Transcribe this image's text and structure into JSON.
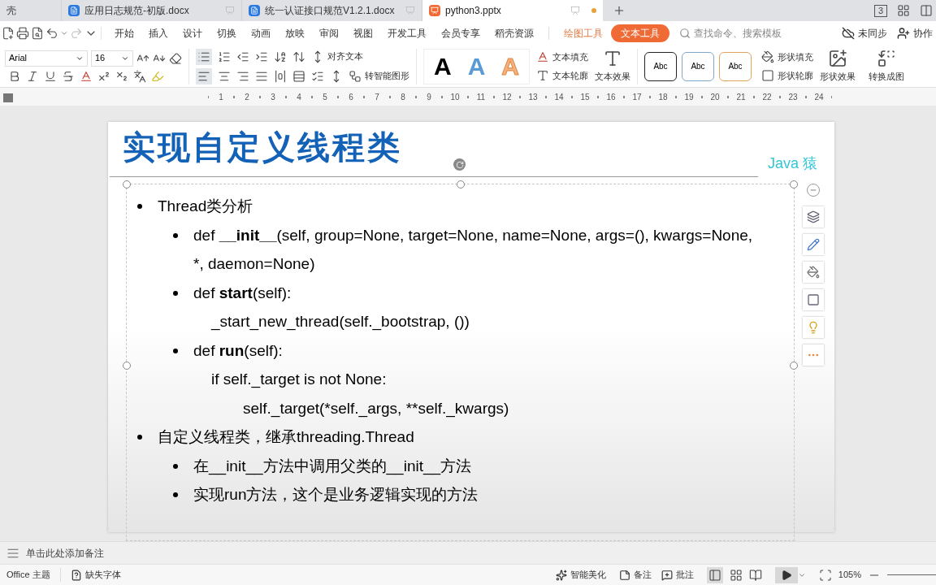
{
  "tabs": [
    {
      "label": "壳",
      "kind": "plain",
      "selected": false,
      "unsaved": false
    },
    {
      "label": "应用日志规范-初版.docx",
      "kind": "writer",
      "selected": false,
      "unsaved": false
    },
    {
      "label": "统一认证接口规范V1.2.1.docx",
      "kind": "writer",
      "selected": false,
      "unsaved": false
    },
    {
      "label": "python3.pptx",
      "kind": "presentation",
      "selected": true,
      "unsaved": true
    }
  ],
  "tab_count": "3",
  "menu": [
    {
      "label": "开始",
      "kind": "tab",
      "selected": false
    },
    {
      "label": "插入",
      "kind": "tab",
      "selected": false
    },
    {
      "label": "设计",
      "kind": "tab",
      "selected": false
    },
    {
      "label": "切换",
      "kind": "tab",
      "selected": false
    },
    {
      "label": "动画",
      "kind": "tab",
      "selected": false
    },
    {
      "label": "放映",
      "kind": "tab",
      "selected": false
    },
    {
      "label": "审阅",
      "kind": "tab",
      "selected": false
    },
    {
      "label": "视图",
      "kind": "tab",
      "selected": false
    },
    {
      "label": "开发工具",
      "kind": "tab",
      "selected": false
    },
    {
      "label": "会员专享",
      "kind": "tab",
      "selected": false
    },
    {
      "label": "稻壳资源",
      "kind": "tab",
      "selected": false
    },
    {
      "label": "绘图工具",
      "kind": "context",
      "selected": false
    },
    {
      "label": "文本工具",
      "kind": "context",
      "selected": true
    }
  ],
  "search": {
    "placeholder": "查找命令、搜索模板"
  },
  "sync": "未同步",
  "collab": "协作",
  "ribbon": {
    "font": "Arial",
    "size": "16",
    "align_text": "对齐文本",
    "smart_art": "转智能图形",
    "wordart_styles": [
      {
        "label": "A",
        "kind": "black"
      },
      {
        "label": "A",
        "kind": "blue"
      },
      {
        "label": "A",
        "kind": "orange"
      }
    ],
    "text_fill": "文本填充",
    "text_outline": "文本轮廓",
    "text_effect": "文本效果",
    "shape_styles": [
      {
        "label": "Abc",
        "color": "#222222"
      },
      {
        "label": "Abc",
        "color": "#7fa7c9"
      },
      {
        "label": "Abc",
        "color": "#e0a45c"
      }
    ],
    "shape_fill": "形状填充",
    "shape_outline": "形状轮廓",
    "shape_effect": "形状效果",
    "convert": "转换成图"
  },
  "ruler": [
    "1",
    "2",
    "3",
    "4",
    "5",
    "6",
    "7",
    "8",
    "9",
    "10",
    "11",
    "12",
    "13",
    "14",
    "15",
    "16",
    "17",
    "18",
    "19",
    "20",
    "21",
    "22",
    "23",
    "24"
  ],
  "slide": {
    "title": "实现自定义线程类",
    "brand": "Java 猿",
    "items": [
      {
        "bullet": true,
        "text": "Thread类分析",
        "children": [
          {
            "bullet": true,
            "rich_text": "def **__init__**(self, group=None, target=None, name=None, args=(), kwargs=None, *, daemon=None)"
          },
          {
            "bullet": true,
            "rich_text": "def **start**(self):",
            "children": [
              {
                "bullet": false,
                "text": "_start_new_thread(self._bootstrap, ())"
              }
            ]
          },
          {
            "bullet": true,
            "rich_text": "def **run**(self):",
            "children": [
              {
                "bullet": false,
                "text": "if self._target is not None:",
                "children": [
                  {
                    "bullet": false,
                    "text": "self._target(*self._args, **self._kwargs)"
                  }
                ]
              }
            ]
          }
        ]
      },
      {
        "bullet": true,
        "text": "自定义线程类，继承threading.Thread",
        "children": [
          {
            "bullet": true,
            "text": "在__init__方法中调用父类的__init__方法"
          },
          {
            "bullet": true,
            "text": "实现run方法，这个是业务逻辑实现的方法"
          }
        ]
      }
    ]
  },
  "notes_placeholder": "单击此处添加备注",
  "status": {
    "theme": "Office 主题",
    "missing_fonts": "缺失字体",
    "beautify": "智能美化",
    "notes": "备注",
    "comments": "批注",
    "zoom": "105%"
  }
}
